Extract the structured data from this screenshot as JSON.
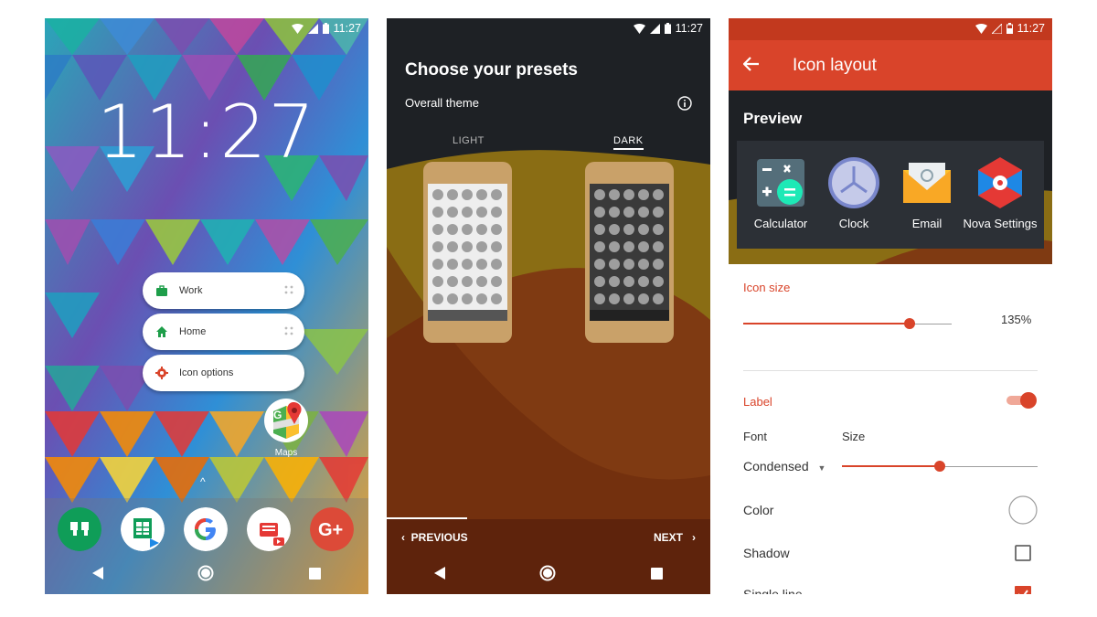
{
  "status": {
    "time": "11:27"
  },
  "launcher": {
    "clock": "11:27",
    "shortcuts": [
      {
        "label": "Work",
        "icon": "briefcase-icon"
      },
      {
        "label": "Home",
        "icon": "home-icon"
      },
      {
        "label": "Icon options",
        "icon": "gear-icon"
      }
    ],
    "app_label": "Maps",
    "dock": [
      "hangouts-icon",
      "sheets-icon",
      "google-icon",
      "youtube-icon",
      "google-plus-icon"
    ]
  },
  "presets": {
    "title": "Choose your presets",
    "subtitle": "Overall theme",
    "tabs": {
      "light": "LIGHT",
      "dark": "DARK"
    },
    "selected_tab": "DARK",
    "previous": "PREVIOUS",
    "next": "NEXT"
  },
  "icon_layout": {
    "title": "Icon layout",
    "preview_title": "Preview",
    "apps": [
      "Calculator",
      "Clock",
      "Email",
      "Nova Settings"
    ],
    "icon_size_label": "Icon size",
    "icon_size_value": "135%",
    "icon_size_fraction": 0.8,
    "label_section": "Label",
    "label_enabled": true,
    "font_label": "Font",
    "font_value": "Condensed",
    "size_label": "Size",
    "size_fraction": 0.5,
    "color_label": "Color",
    "shadow_label": "Shadow",
    "single_line_label": "Single line",
    "accent": "#d9442a"
  }
}
